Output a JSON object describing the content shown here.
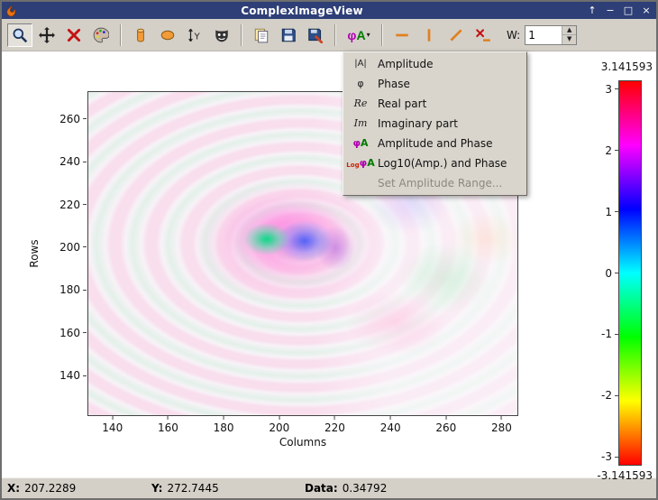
{
  "window": {
    "title": "ComplexImageView",
    "controls": {
      "pin": "↑",
      "minimize": "−",
      "maximize": "□",
      "close": "×"
    }
  },
  "toolbar": {
    "buttons": [
      "zoom",
      "pan",
      "clear",
      "palette",
      "cylinder-roi",
      "ellipse-roi",
      "y-profile",
      "mask",
      "copy",
      "save",
      "export",
      "display-mode",
      "horizontal-line",
      "vertical-line",
      "diagonal-line",
      "remove-line"
    ],
    "display_button": {
      "phi": "φ",
      "a": "A",
      "arrow": "▾"
    },
    "width_label": "W:",
    "width_value": "1"
  },
  "menu": {
    "items": [
      {
        "icon": "|A|",
        "icon_type": "amplitude",
        "label": "Amplitude",
        "enabled": true
      },
      {
        "icon": "φ",
        "icon_type": "phase",
        "label": "Phase",
        "enabled": true
      },
      {
        "icon": "Re",
        "icon_type": "real",
        "label": "Real part",
        "enabled": true
      },
      {
        "icon": "Im",
        "icon_type": "imag",
        "label": "Imaginary part",
        "enabled": true
      },
      {
        "icon": "φA",
        "icon_type": "amp-phase",
        "label": "Amplitude and Phase",
        "enabled": true,
        "icon_segments": [
          {
            "text": "φ",
            "class": "phi"
          },
          {
            "text": "A",
            "class": "aa"
          }
        ]
      },
      {
        "icon": "LogφA",
        "icon_type": "log-amp-phase",
        "label": "Log10(Amp.) and Phase",
        "enabled": true,
        "icon_segments": [
          {
            "text": "Log",
            "class": "log"
          },
          {
            "text": "φ",
            "class": "phi"
          },
          {
            "text": "A",
            "class": "aa"
          }
        ]
      },
      {
        "icon": "",
        "icon_type": "none",
        "label": "Set Amplitude Range...",
        "enabled": false
      }
    ]
  },
  "chart_data": {
    "type": "heatmap",
    "title": "",
    "xlabel": "Columns",
    "ylabel": "Rows",
    "xticks": [
      140,
      160,
      180,
      200,
      220,
      240,
      260,
      280
    ],
    "yticks": [
      260,
      240,
      220,
      200,
      180,
      160,
      140
    ],
    "xlim": [
      131,
      286
    ],
    "ylim": [
      121,
      273
    ],
    "colorbar": {
      "max_label": "3.141593",
      "min_label": "-3.141593",
      "ticks": [
        3,
        2,
        1,
        0,
        -1,
        -2,
        -3
      ],
      "clim": [
        -3.141593,
        3.141593
      ],
      "colors": [
        "#ff0000",
        "#ff00ff",
        "#0000ff",
        "#00ffff",
        "#00ff00",
        "#ffff00",
        "#ff0000"
      ]
    }
  },
  "statusbar": {
    "x_label": "X:",
    "x_value": "207.2289",
    "y_label": "Y:",
    "y_value": "272.7445",
    "data_label": "Data:",
    "data_value": "0.34792"
  }
}
